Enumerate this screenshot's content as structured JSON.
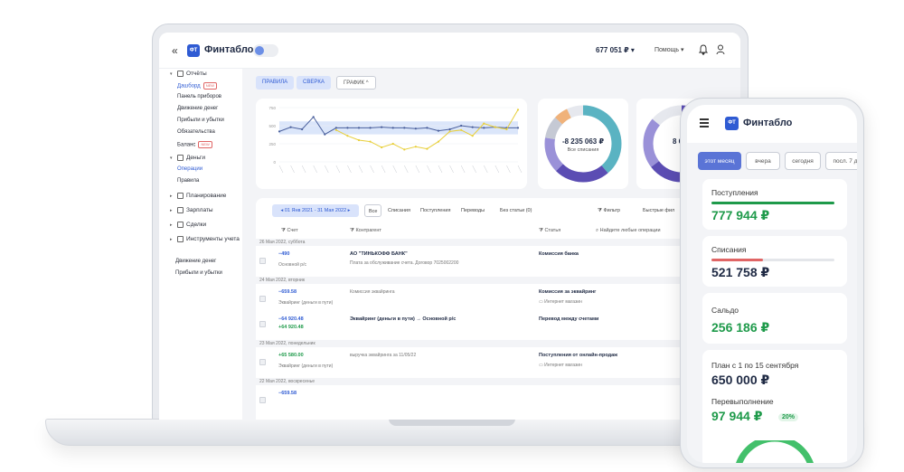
{
  "header": {
    "logo_badge": "ФТ",
    "logo_text": "Финтабло",
    "balance": "677 051 ₽ ▾",
    "help": "Помощь ▾"
  },
  "sidebar": {
    "sections": [
      {
        "label": "Отчёты",
        "arrow": "▾"
      },
      {
        "label": "Деньги",
        "arrow": "▾"
      },
      {
        "label": "Планирование",
        "arrow": "▸"
      },
      {
        "label": "Зарплаты",
        "arrow": "▸"
      },
      {
        "label": "Сделки",
        "arrow": "▸"
      },
      {
        "label": "Инструменты учета",
        "arrow": "▸"
      }
    ],
    "reports_items": [
      "Дашборд",
      "Панель приборов",
      "Движение денег",
      "Прибыли и убытки",
      "Обязательства",
      "Баланс"
    ],
    "money_items": [
      "Операции",
      "Правила"
    ],
    "new_badge": "NEW",
    "footer_links": [
      "Движение денег",
      "Прибыли и убытки"
    ]
  },
  "toolbar": {
    "tabs": [
      "ПРАВИЛА",
      "СВЕРКА",
      "ГРАФИК ^"
    ]
  },
  "chart_data": {
    "type": "line",
    "title": "",
    "xlabel": "",
    "ylabel": "",
    "yticks": [
      "750",
      "500",
      "250",
      "0"
    ],
    "ylim": [
      0,
      750
    ],
    "band": [
      380,
      560
    ],
    "series": [
      {
        "values": [
          420,
          480,
          450,
          620,
          380,
          470,
          470,
          470,
          470,
          480,
          470,
          470,
          460,
          470,
          430,
          450,
          500,
          480,
          470,
          480,
          470,
          470
        ]
      },
      {
        "values": [
          null,
          null,
          null,
          null,
          null,
          440,
          360,
          300,
          280,
          200,
          250,
          170,
          210,
          180,
          280,
          420,
          440,
          360,
          530,
          480,
          450,
          720
        ]
      }
    ],
    "colors": [
      "#4a5f9c",
      "#e8cf3a"
    ]
  },
  "donuts": [
    {
      "amount": "-8 235 063 ₽",
      "label": "Все списания"
    },
    {
      "amount": "8 635",
      "label": ""
    }
  ],
  "table": {
    "date_range": "◂  01 Янв 2021 - 31 Мая 2022  ▸",
    "filter_tabs": [
      "Все",
      "Списания",
      "Поступления",
      "Переводы",
      "Без статьи (0)"
    ],
    "filter_label": "Фильтр",
    "quick_filter": "Быстрые фил",
    "search_placeholder": "Найдите любые операции",
    "columns": [
      "Счет",
      "Контрагент",
      "Статья"
    ],
    "groups": [
      {
        "date": "26 Мая 2022, суббота",
        "rows": [
          {
            "amount": "−490",
            "account": "Основной р/с",
            "counterparty": "АО \"ТИНЬКОФФ БАНК\"",
            "comment": "Плата за обслуживание счета. Договор 7025002200",
            "category": "Комиссия банка",
            "sub": ""
          }
        ]
      },
      {
        "date": "24 Мая 2022, вторник",
        "rows": [
          {
            "amount": "−659.58",
            "account": "Эквайринг (деньги в пути)",
            "counterparty": "",
            "comment": "Комиссия эквайринга",
            "category": "Комиссия за эквайринг",
            "sub": "Интернет магазин"
          },
          {
            "amount": "−64 920.48",
            "amount2": "+64 920.48",
            "account": "",
            "counterparty": "Эквайринг (деньги в пути)  →  Основной р/с",
            "comment": "",
            "category": "Перевод между счетами",
            "sub": ""
          }
        ]
      },
      {
        "date": "23 Мая 2022, понедельник",
        "rows": [
          {
            "amount": "+65 580.00",
            "account": "Эквайринг (деньги в пути)",
            "counterparty": "",
            "comment": "выручка эквайринга за 11/05/22",
            "category": "Поступления от онлайн-продаж",
            "sub": "Интернет магазин"
          }
        ]
      },
      {
        "date": "22 Мая 2022, воскресенье",
        "rows": [
          {
            "amount": "−659.58",
            "account": "",
            "counterparty": "",
            "comment": "",
            "category": "",
            "sub": ""
          }
        ]
      }
    ]
  },
  "phone": {
    "logo_badge": "ФТ",
    "logo_text": "Финтабло",
    "chips": [
      "этот месяц",
      "вчера",
      "сегодня",
      "посл. 7 д"
    ],
    "income": {
      "label": "Поступления",
      "value": "777 944 ₽",
      "progress": 1.0,
      "color": "#1e9a4a"
    },
    "expense": {
      "label": "Списания",
      "value": "521 758 ₽",
      "progress": 0.42,
      "color": "#e06565"
    },
    "balance": {
      "label": "Сальдо",
      "value": "256 186 ₽",
      "color": "#1e9a4a"
    },
    "plan": {
      "label": "План с 1 по 15 сентября",
      "value": "650 000 ₽"
    },
    "overfulfill": {
      "label": "Перевыполнение",
      "value": "97 944 ₽",
      "percent": "20%"
    }
  }
}
